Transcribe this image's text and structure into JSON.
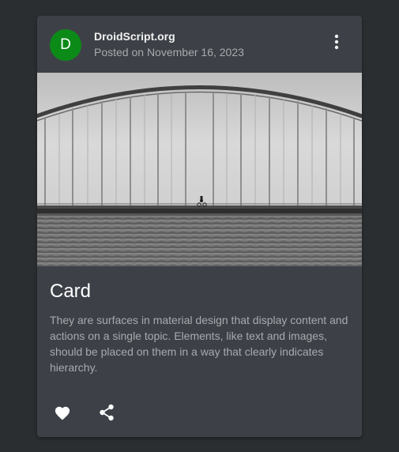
{
  "card": {
    "avatar_letter": "D",
    "title": "DroidScript.org",
    "subtitle": "Posted on November 16, 2023",
    "headline": "Card",
    "supporting_text": "They are surfaces in material design that display content and actions on a single topic. Elements, like text and images, should be placed on them in a way that clearly indicates hierarchy.",
    "media": {
      "icon": "bridge-photo"
    },
    "actions": [
      {
        "icon": "heart-icon"
      },
      {
        "icon": "share-icon"
      }
    ]
  },
  "colors": {
    "background": "#2b2e31",
    "card": "#3d4147",
    "avatar": "#0c8a18",
    "text_primary": "#ffffff",
    "text_secondary": "#a7aaad"
  }
}
